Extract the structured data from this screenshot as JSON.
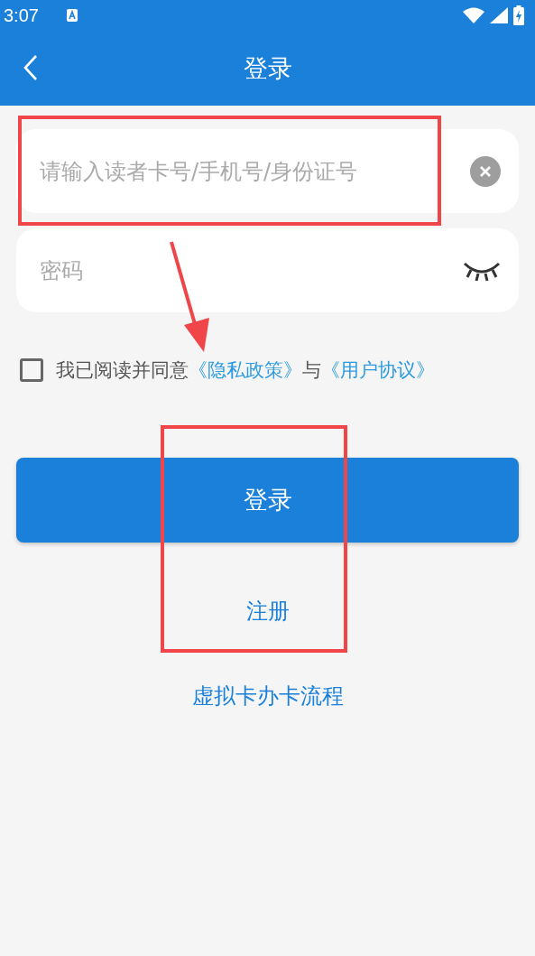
{
  "status_bar": {
    "time": "3:07"
  },
  "header": {
    "title": "登录"
  },
  "account_field": {
    "placeholder": "请输入读者卡号/手机号/身份证号"
  },
  "password_field": {
    "placeholder": "密码",
    "visible": false
  },
  "agreement": {
    "checked": false,
    "text": "我已阅读并同意",
    "privacy_link": "《隐私政策》",
    "joiner": "与",
    "terms_link": "《用户协议》"
  },
  "login_button": "登录",
  "register_link": "注册",
  "virtual_card_link": "虚拟卡办卡流程",
  "annotation_marks": [
    {
      "kind": "box"
    },
    {
      "kind": "arrow"
    },
    {
      "kind": "box"
    }
  ]
}
